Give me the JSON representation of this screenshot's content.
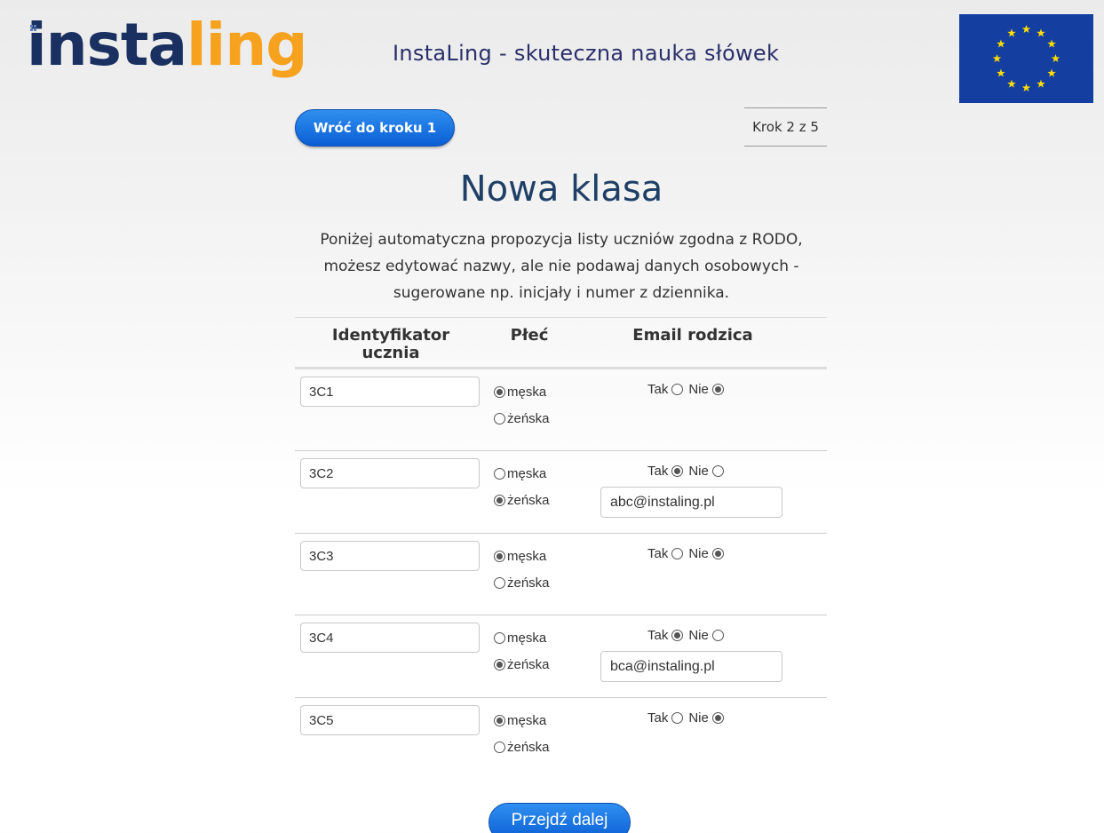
{
  "logo": {
    "part1": "insta",
    "part2": "ling"
  },
  "site_title": "InstaLing - skuteczna nauka słówek",
  "back_button": "Wróć do kroku 1",
  "step_indicator": "Krok 2 z 5",
  "page_title": "Nowa klasa",
  "intro_lines": [
    "Poniżej automatyczna propozycja listy uczniów zgodna z RODO,",
    "możesz edytować nazwy, ale nie podawaj danych osobowych -",
    "sugerowane np. inicjały i numer z dziennika."
  ],
  "table_headers": {
    "id_line1": "Identyfikator",
    "id_line2": "ucznia",
    "gender": "Płeć",
    "email": "Email rodzica"
  },
  "labels": {
    "male": "męska",
    "female": "żeńska",
    "yes": "Tak",
    "no": "Nie"
  },
  "students": [
    {
      "id": "3C1",
      "gender": "male",
      "email_yes": false,
      "email": ""
    },
    {
      "id": "3C2",
      "gender": "female",
      "email_yes": true,
      "email": "abc@instaling.pl"
    },
    {
      "id": "3C3",
      "gender": "male",
      "email_yes": false,
      "email": ""
    },
    {
      "id": "3C4",
      "gender": "female",
      "email_yes": true,
      "email": "bca@instaling.pl"
    },
    {
      "id": "3C5",
      "gender": "male",
      "email_yes": false,
      "email": ""
    }
  ],
  "next_button": "Przejdź dalej",
  "colors": {
    "primary_blue": "#1a6fe0",
    "logo_dark": "#1a3060",
    "logo_orange": "#f6a21e",
    "eu_blue": "#143fa0",
    "eu_star": "#ffdd00"
  }
}
